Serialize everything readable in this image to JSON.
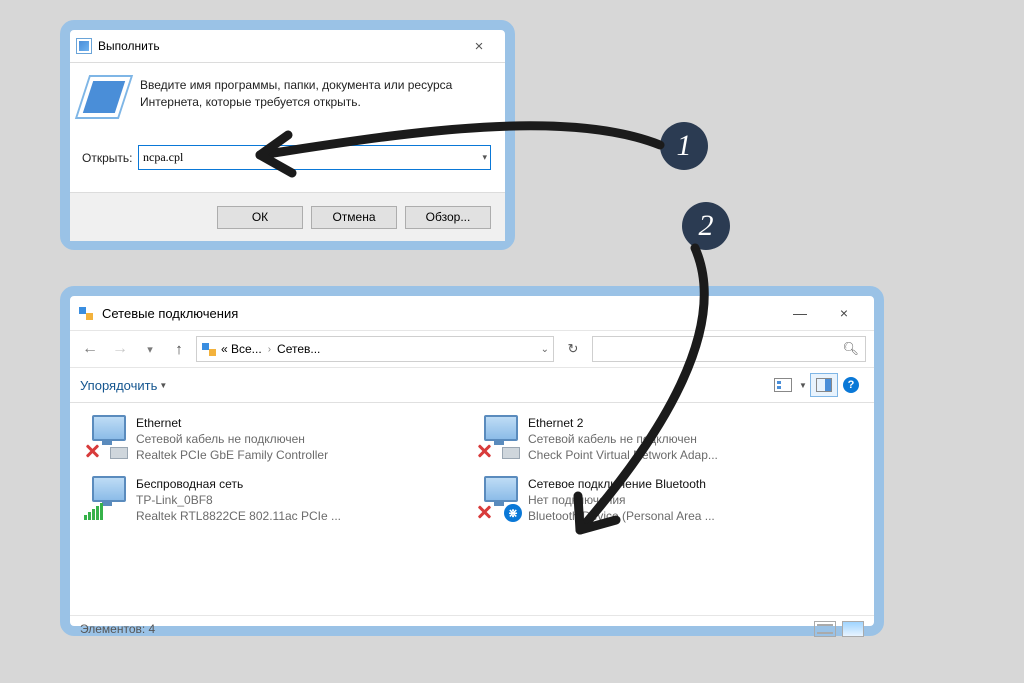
{
  "annotations": {
    "step1": "1",
    "step2": "2"
  },
  "runDialog": {
    "title": "Выполнить",
    "description": "Введите имя программы, папки, документа или ресурса Интернета, которые требуется открыть.",
    "openLabel": "Открыть:",
    "value": "ncpa.cpl",
    "ok": "ОК",
    "cancel": "Отмена",
    "browse": "Обзор..."
  },
  "explorer": {
    "title": "Сетевые подключения",
    "minimize": "—",
    "close": "×",
    "breadcrumb1": "« Все...",
    "breadcrumb2": "Сетев...",
    "organize": "Упорядочить",
    "help": "?",
    "status": "Элементов: 4",
    "connections": [
      {
        "name": "Ethernet",
        "status": "Сетевой кабель не подключен",
        "device": "Realtek PCIe GbE Family Controller",
        "kind": "wired-down"
      },
      {
        "name": "Ethernet 2",
        "status": "Сетевой кабель не подключен",
        "device": "Check Point Virtual Network Adap...",
        "kind": "wired-down"
      },
      {
        "name": "Беспроводная сеть",
        "status": "TP-Link_0BF8",
        "device": "Realtek RTL8822CE 802.11ac PCIe ...",
        "kind": "wifi-up"
      },
      {
        "name": "Сетевое подключение Bluetooth",
        "status": "Нет подключения",
        "device": "Bluetooth Device (Personal Area ...",
        "kind": "bt-down"
      }
    ]
  }
}
